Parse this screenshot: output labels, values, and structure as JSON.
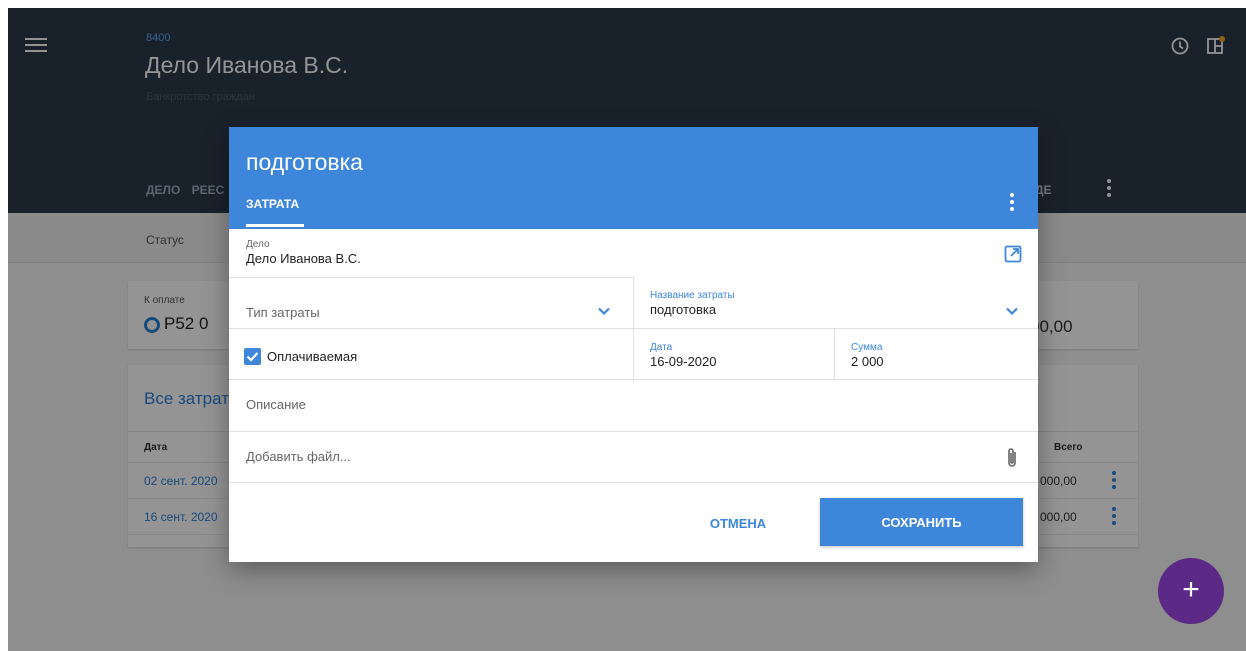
{
  "case": {
    "number": "8400",
    "title": "Дело Иванова В.С.",
    "subtitle": "Банкротство граждан"
  },
  "header": {
    "tabs": [
      "ДЕЛО",
      "РЕЕС"
    ],
    "right_tab": "ДЕ",
    "icons": [
      "clock-icon",
      "panel-icon"
    ]
  },
  "status": {
    "label": "Статус"
  },
  "summary": {
    "label": "К оплате",
    "value": "Р52 0",
    "right_value": "00,00"
  },
  "expenses": {
    "title": "Все затрат",
    "col_date": "Дата",
    "col_total": "Всего",
    "rows": [
      {
        "date": "02 сент. 2020",
        "total": "0 000,00"
      },
      {
        "date": "16 сент. 2020",
        "total": "2 000,00"
      }
    ]
  },
  "dialog": {
    "title": "подготовка",
    "tab": "ЗАТРАТА",
    "case_label": "Дело",
    "case_value": "Дело Иванова В.С.",
    "type_placeholder": "Тип затраты",
    "name_label": "Название затраты",
    "name_value": "подготовка",
    "paid_label": "Оплачиваемая",
    "paid_checked": true,
    "date_label": "Дата",
    "date_value": "16-09-2020",
    "sum_label": "Сумма",
    "sum_value": "2 000",
    "description_placeholder": "Описание",
    "file_placeholder": "Добавить файл...",
    "cancel_label": "ОТМЕНА",
    "save_label": "СОХРАНИТЬ"
  },
  "fab": {
    "label": "+"
  },
  "colors": {
    "header_bg": "#2b3a4b",
    "accent": "#3d86da",
    "fab": "#5b2a86",
    "notify_dot": "#f5a623"
  }
}
